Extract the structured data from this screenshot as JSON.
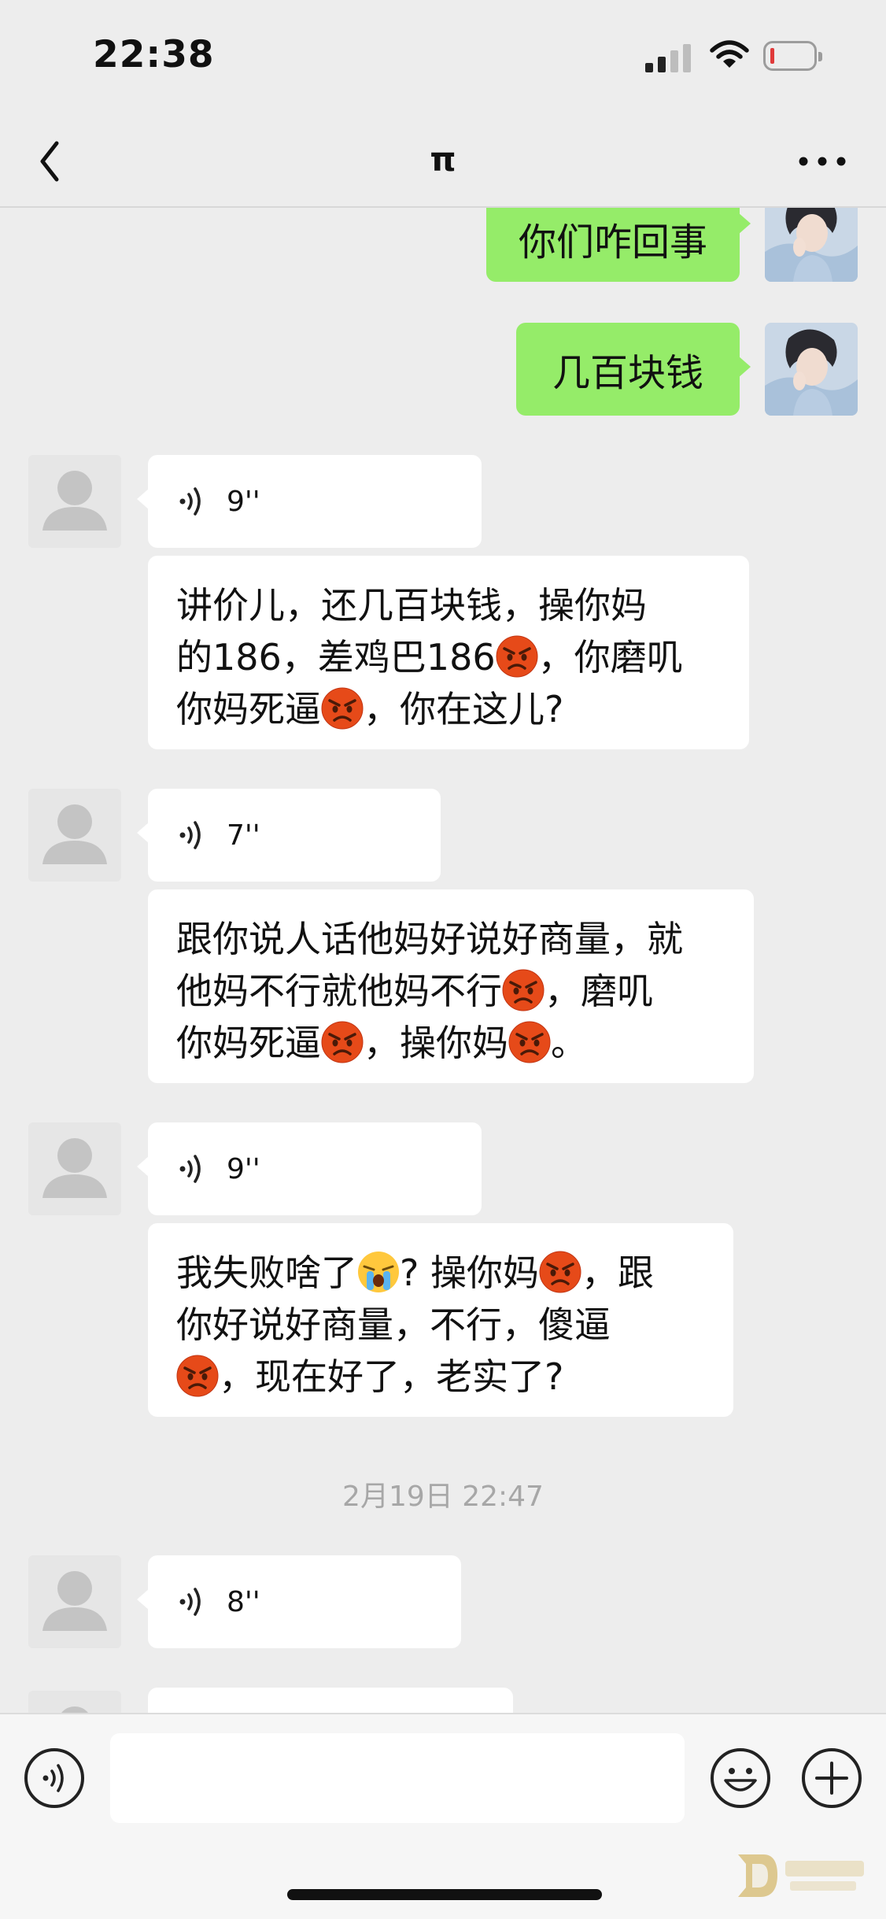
{
  "status_bar": {
    "time": "22:38"
  },
  "header": {
    "title": "π"
  },
  "messages": {
    "sent_1": "你们咋回事",
    "sent_2": "几百块钱",
    "voice_1": "9''",
    "text_1": {
      "a": "讲价儿，还几百块钱，操你妈",
      "b": "的186，差鸡巴186",
      "c": "，你磨叽",
      "d": "你妈死逼",
      "e": "，你在这儿?"
    },
    "voice_2": "7''",
    "text_2": {
      "a": "跟你说人话他妈好说好商量，就",
      "b": "他妈不行就他妈不行",
      "c": "，磨叽",
      "d": "你妈死逼",
      "e": "，操你妈",
      "f": "。"
    },
    "voice_3": "9''",
    "text_3": {
      "a": "我失败啥了",
      "b": "? 操你妈",
      "c": "，跟",
      "d": "你好说好商量，不行，傻逼",
      "e": "，现在好了，老实了?"
    },
    "timestamp": "2月19日 22:47",
    "voice_4": "8''"
  },
  "icons": {
    "angry": "pouting-face-emoji",
    "crying": "loudly-crying-face-emoji",
    "back": "chevron-left-icon",
    "more": "more-dots-icon",
    "voice": "voice-wave-icon",
    "emoji": "smiley-icon",
    "plus": "plus-circle-icon"
  },
  "colors": {
    "background": "#ededed",
    "sent_bubble": "#95ec69",
    "received_bubble": "#ffffff",
    "battery_low": "#e03a3a",
    "timestamp_text": "#a7a7a7"
  },
  "input": {
    "value": "",
    "placeholder": ""
  }
}
